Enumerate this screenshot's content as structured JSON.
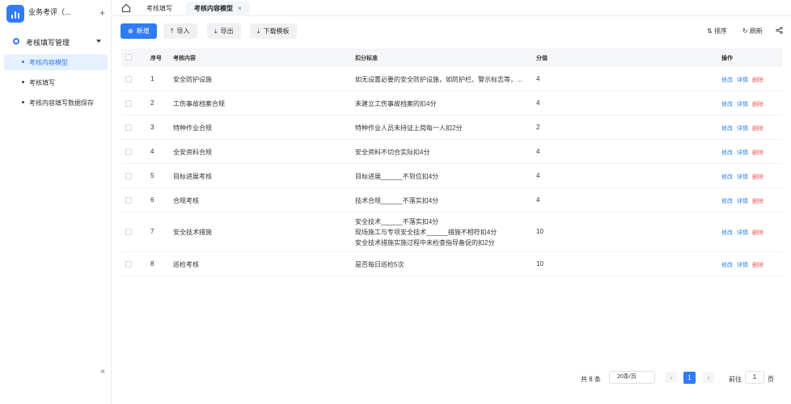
{
  "brand": {
    "title": "业务考评（..."
  },
  "sidebar": {
    "group_label": "考核填写管理",
    "items": [
      {
        "label": "考核内容模型",
        "active": true
      },
      {
        "label": "考核填写",
        "active": false
      },
      {
        "label": "考核内容填写数据保存",
        "active": false
      }
    ],
    "collapse_glyph": "«"
  },
  "tabs": [
    {
      "label": "考核填写"
    },
    {
      "label": "考核内容模型",
      "close": "×"
    }
  ],
  "toolbar": {
    "add_label": "新增",
    "import_label": "导入",
    "export_label": "导出",
    "download_template_label": "下载模板",
    "sort_label": "排序",
    "refresh_label": "刷新"
  },
  "table": {
    "headers": {
      "index": "序号",
      "content": "考核内容",
      "standard": "扣分标准",
      "score": "分值",
      "ops": "操作"
    },
    "rows": [
      {
        "index": "1",
        "content": "安全防护设施",
        "standard": [
          "如无设置必要的安全防护设施，如防护栏、警示标志等，..."
        ],
        "score": "4"
      },
      {
        "index": "2",
        "content": "工伤事故档案合规",
        "standard": [
          "未建立工伤事故档案的扣4分"
        ],
        "score": "4"
      },
      {
        "index": "3",
        "content": "特种作业合规",
        "standard": [
          "特种作业人员未持证上岗每一人扣2分"
        ],
        "score": "2"
      },
      {
        "index": "4",
        "content": "全安资料合规",
        "standard": [
          "安全资料不切合实际扣4分"
        ],
        "score": "4"
      },
      {
        "index": "5",
        "content": "目标进展考核",
        "standard": [
          "目标进展______不到位扣4分"
        ],
        "score": "4"
      },
      {
        "index": "6",
        "content": "合规考核",
        "standard": [
          "技术合规______不落实扣4分"
        ],
        "score": "4"
      },
      {
        "index": "7",
        "content": "安全技术措施",
        "standard": [
          "安全技术______不落实扣4分",
          "现场施工与专项安全技术______措施不相符扣4分",
          "安全技术措施实施过程中未检查指导备促的扣2分"
        ],
        "score": "10"
      },
      {
        "index": "8",
        "content": "巡检考核",
        "standard": [
          "是否每日巡检5次"
        ],
        "score": "10"
      }
    ],
    "op_edit": "修改",
    "op_detail": "详情",
    "op_delete": "删除"
  },
  "pagination": {
    "total": "共 8 条",
    "page_size": "20条/页",
    "current_page": "1",
    "prev_glyph": "‹",
    "next_glyph": "›",
    "goto_label": "前往",
    "goto_value": "1",
    "goto_unit": "页"
  },
  "colors": {
    "accent": "#2f7cf6",
    "danger": "#f05a5a"
  },
  "icons": [
    "app-logo-icon",
    "plus-icon",
    "circle-icon",
    "caret-down-icon",
    "home-icon",
    "close-icon",
    "add-icon",
    "upload-icon",
    "download-icon",
    "sort-icon",
    "refresh-icon",
    "share-icon",
    "collapse-icon",
    "chevron-left-icon",
    "chevron-right-icon"
  ]
}
